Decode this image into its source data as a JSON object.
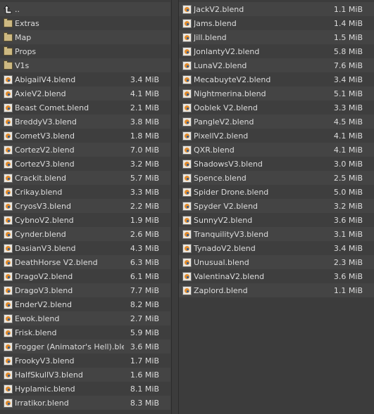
{
  "left_column": [
    {
      "name": "..",
      "size": "",
      "type": "parent"
    },
    {
      "name": "Extras",
      "size": "",
      "type": "folder"
    },
    {
      "name": "Map",
      "size": "",
      "type": "folder"
    },
    {
      "name": "Props",
      "size": "",
      "type": "folder"
    },
    {
      "name": "V1s",
      "size": "",
      "type": "folder"
    },
    {
      "name": "AbigailV4.blend",
      "size": "3.4 MiB",
      "type": "blend"
    },
    {
      "name": "AxieV2.blend",
      "size": "4.1 MiB",
      "type": "blend"
    },
    {
      "name": "Beast Comet.blend",
      "size": "2.1 MiB",
      "type": "blend"
    },
    {
      "name": "BreddyV3.blend",
      "size": "3.8 MiB",
      "type": "blend"
    },
    {
      "name": "CometV3.blend",
      "size": "1.8 MiB",
      "type": "blend"
    },
    {
      "name": "CortezV2.blend",
      "size": "7.0 MiB",
      "type": "blend"
    },
    {
      "name": "CortezV3.blend",
      "size": "3.2 MiB",
      "type": "blend"
    },
    {
      "name": "Crackit.blend",
      "size": "5.7 MiB",
      "type": "blend"
    },
    {
      "name": "Crikay.blend",
      "size": "3.3 MiB",
      "type": "blend"
    },
    {
      "name": "CryosV3.blend",
      "size": "2.2 MiB",
      "type": "blend"
    },
    {
      "name": "CybnoV2.blend",
      "size": "1.9 MiB",
      "type": "blend"
    },
    {
      "name": "Cynder.blend",
      "size": "2.6 MiB",
      "type": "blend"
    },
    {
      "name": "DasianV3.blend",
      "size": "4.3 MiB",
      "type": "blend"
    },
    {
      "name": "DeathHorse V2.blend",
      "size": "6.3 MiB",
      "type": "blend"
    },
    {
      "name": "DragoV2.blend",
      "size": "6.1 MiB",
      "type": "blend"
    },
    {
      "name": "DragoV3.blend",
      "size": "7.7 MiB",
      "type": "blend"
    },
    {
      "name": "EnderV2.blend",
      "size": "8.2 MiB",
      "type": "blend"
    },
    {
      "name": "Ewok.blend",
      "size": "2.7 MiB",
      "type": "blend"
    },
    {
      "name": "Frisk.blend",
      "size": "5.9 MiB",
      "type": "blend"
    },
    {
      "name": "Frogger (Animator's Hell).blend",
      "size": "3.6 MiB",
      "type": "blend"
    },
    {
      "name": "FrookyV3.blend",
      "size": "1.7 MiB",
      "type": "blend"
    },
    {
      "name": "HalfSkullV3.blend",
      "size": "1.6 MiB",
      "type": "blend"
    },
    {
      "name": "Hyplamic.blend",
      "size": "8.1 MiB",
      "type": "blend"
    },
    {
      "name": "Irratikor.blend",
      "size": "8.3 MiB",
      "type": "blend"
    }
  ],
  "right_column": [
    {
      "name": "JackV2.blend",
      "size": "1.1 MiB",
      "type": "blend"
    },
    {
      "name": "Jams.blend",
      "size": "1.4 MiB",
      "type": "blend"
    },
    {
      "name": "Jill.blend",
      "size": "1.5 MiB",
      "type": "blend"
    },
    {
      "name": "JonlantyV2.blend",
      "size": "5.8 MiB",
      "type": "blend"
    },
    {
      "name": "LunaV2.blend",
      "size": "7.6 MiB",
      "type": "blend"
    },
    {
      "name": "MecabuyteV2.blend",
      "size": "3.4 MiB",
      "type": "blend"
    },
    {
      "name": "Nightmerina.blend",
      "size": "5.1 MiB",
      "type": "blend"
    },
    {
      "name": "Ooblek V2.blend",
      "size": "3.3 MiB",
      "type": "blend"
    },
    {
      "name": "PangleV2.blend",
      "size": "4.5 MiB",
      "type": "blend"
    },
    {
      "name": "PixellV2.blend",
      "size": "4.1 MiB",
      "type": "blend"
    },
    {
      "name": "QXR.blend",
      "size": "4.1 MiB",
      "type": "blend"
    },
    {
      "name": "ShadowsV3.blend",
      "size": "3.0 MiB",
      "type": "blend"
    },
    {
      "name": "Spence.blend",
      "size": "2.5 MiB",
      "type": "blend"
    },
    {
      "name": "Spider Drone.blend",
      "size": "5.0 MiB",
      "type": "blend"
    },
    {
      "name": "Spyder V2.blend",
      "size": "3.2 MiB",
      "type": "blend"
    },
    {
      "name": "SunnyV2.blend",
      "size": "3.6 MiB",
      "type": "blend"
    },
    {
      "name": "TranquilityV3.blend",
      "size": "3.1 MiB",
      "type": "blend"
    },
    {
      "name": "TynadoV2.blend",
      "size": "3.4 MiB",
      "type": "blend"
    },
    {
      "name": "Unusual.blend",
      "size": "2.3 MiB",
      "type": "blend"
    },
    {
      "name": "ValentinaV2.blend",
      "size": "3.6 MiB",
      "type": "blend"
    },
    {
      "name": "Zaplord.blend",
      "size": "1.1 MiB",
      "type": "blend"
    }
  ],
  "icons": {
    "parent": "parent-directory-icon",
    "folder": "folder-icon",
    "blend": "blend-file-icon"
  }
}
